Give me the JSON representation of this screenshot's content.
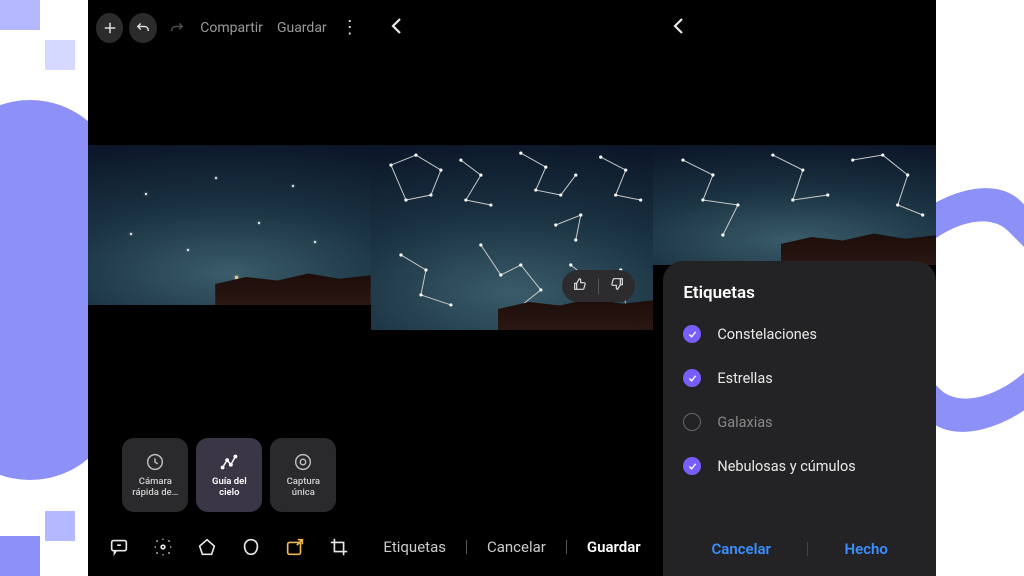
{
  "topbar": {
    "share_label": "Compartir",
    "save_label": "Guardar"
  },
  "modes": {
    "timelapse": "Cámara\nrápida de…",
    "skyguide": "Guía del\ncielo",
    "single": "Captura\núnica"
  },
  "panel2": {
    "tags_label": "Etiquetas",
    "cancel_label": "Cancelar",
    "save_label": "Guardar"
  },
  "sheet": {
    "title": "Etiquetas",
    "items": [
      {
        "label": "Constelaciones",
        "checked": true
      },
      {
        "label": "Estrellas",
        "checked": true
      },
      {
        "label": "Galaxias",
        "checked": false
      },
      {
        "label": "Nebulosas y cúmulos",
        "checked": true
      }
    ],
    "cancel_label": "Cancelar",
    "done_label": "Hecho"
  }
}
